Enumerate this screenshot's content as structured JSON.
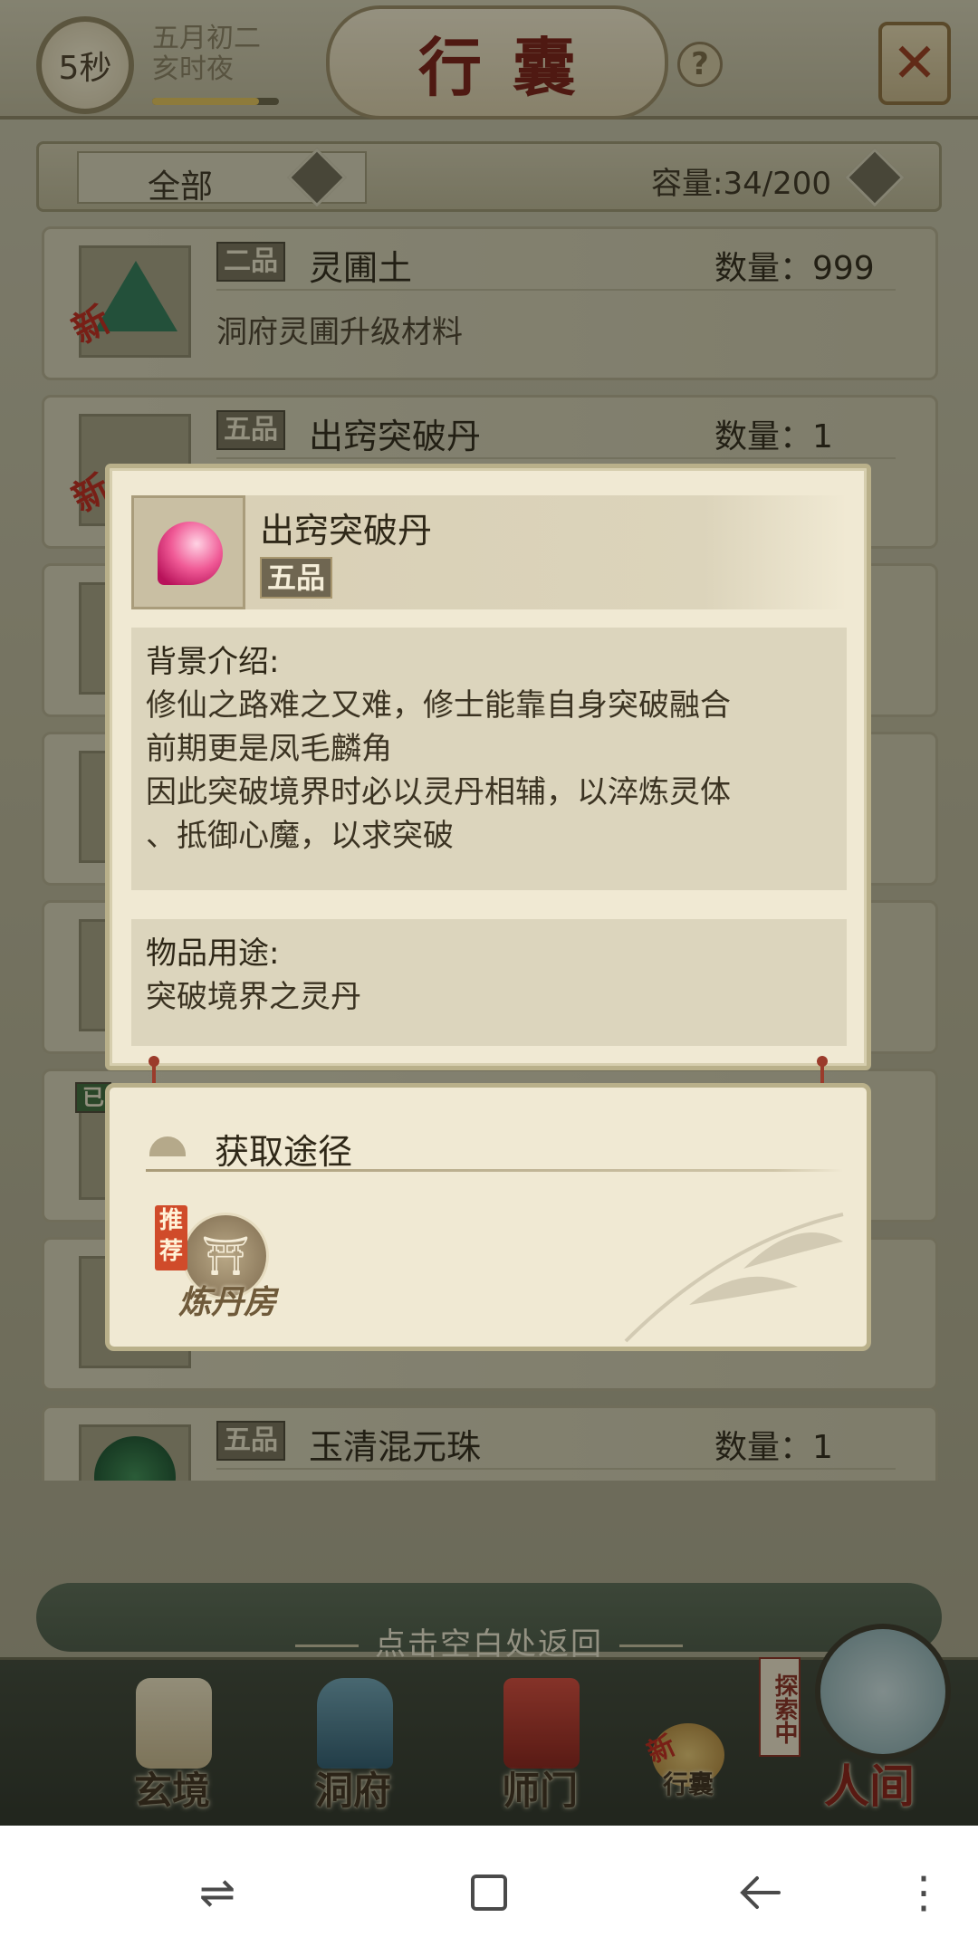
{
  "header": {
    "timer": "5秒",
    "lunar_date": "五月初二",
    "lunar_time": "亥时夜",
    "lunar_progress": 0.84,
    "title": "行囊",
    "help_icon": "question-icon",
    "close_icon": "close-icon"
  },
  "filter": {
    "label": "全部",
    "capacity": "容量:34/200"
  },
  "items": [
    {
      "grade": "二品",
      "name": "灵圃土",
      "qty": "数量：999",
      "desc": "洞府灵圃升级材料",
      "is_new": true,
      "new_label": "新"
    },
    {
      "grade": "五品",
      "name": "出窍突破丹",
      "qty": "数量：1",
      "desc": "",
      "is_new": true,
      "new_label": "新"
    },
    {
      "grade": "",
      "name": "",
      "qty": "",
      "desc": ""
    },
    {
      "grade": "",
      "name": "",
      "qty": "",
      "desc": ""
    },
    {
      "grade": "",
      "name": "",
      "qty": "",
      "desc": ""
    },
    {
      "grade": "",
      "name": "",
      "qty": "",
      "desc": "",
      "tag": "已"
    },
    {
      "grade": "",
      "name": "",
      "qty": "",
      "desc": ""
    },
    {
      "grade": "五品",
      "name": "玉清混元珠",
      "qty": "数量：1",
      "desc": ""
    }
  ],
  "detail": {
    "name": "出窍突破丹",
    "grade": "五品",
    "background_title": "背景介绍:",
    "background_text": "修仙之路难之又难，修士能靠自身突破融合\n前期更是凤毛麟角\n因此突破境界时必以灵丹相辅，以淬炼灵体\n、抵御心魔，以求突破",
    "usage_title": "物品用途:",
    "usage_text": "突破境界之灵丹"
  },
  "sources": {
    "title": "获取途径",
    "recommend_tag": "推荐",
    "items": [
      {
        "label": "炼丹房",
        "icon": "alchemy-pavilion-icon"
      }
    ]
  },
  "return_hint": "点击空白处返回",
  "bottom_nav": [
    {
      "label": "玄境",
      "icon": "scroll-icon"
    },
    {
      "label": "洞府",
      "icon": "pavilion-icon"
    },
    {
      "label": "师门",
      "icon": "banner-icon"
    },
    {
      "label": "行囊",
      "icon": "bag-icon",
      "badge": "新"
    },
    {
      "label": "人间",
      "icon": "world-icon",
      "status": "探索中"
    }
  ],
  "system_nav": [
    "switch-icon",
    "recents-icon",
    "back-icon",
    "menu-icon"
  ]
}
